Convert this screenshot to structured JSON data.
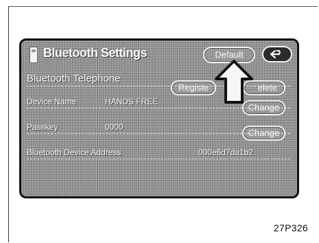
{
  "header": {
    "title": "Bluetooth Settings",
    "default_label": "Default",
    "back_icon": "return-arrow-icon"
  },
  "telephone_row": {
    "label": "Bluetooth Telephone",
    "register_label": "Registe",
    "delete_label": "elete"
  },
  "device_name_row": {
    "label": "Device Name",
    "value": "HANDS FREE",
    "change_label": "Change"
  },
  "passkey_row": {
    "label": "Passkey",
    "value": "0000",
    "change_label": "Change"
  },
  "address_row": {
    "label": "Bluetooth Device Address",
    "value": "000e6d7da1b2"
  },
  "figure_caption": "27P326"
}
